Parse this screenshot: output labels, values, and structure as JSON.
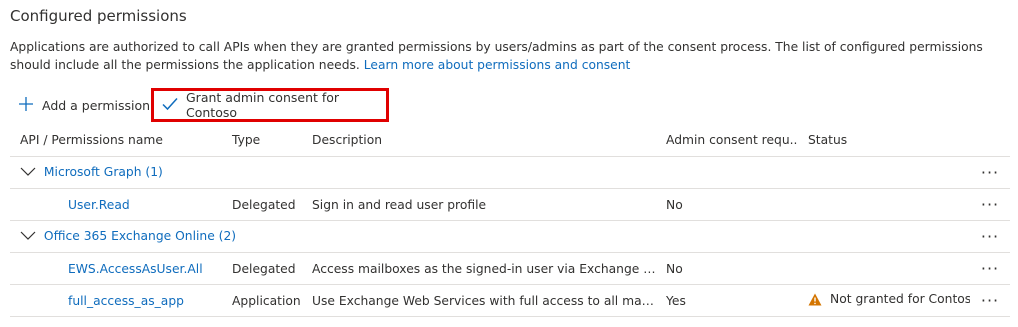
{
  "header": {
    "title": "Configured permissions",
    "description": "Applications are authorized to call APIs when they are granted permissions by users/admins as part of the consent process. The list of configured permissions should include all the permissions the application needs.",
    "learn_more": "Learn more about permissions and consent"
  },
  "toolbar": {
    "add_label": "Add a permission",
    "grant_label": "Grant admin consent for Contoso"
  },
  "table": {
    "columns": [
      "API / Permissions name",
      "Type",
      "Description",
      "Admin consent requ...",
      "Status"
    ],
    "groups": [
      {
        "name": "Microsoft Graph (1)",
        "rows": [
          {
            "name": "User.Read",
            "type": "Delegated",
            "description": "Sign in and read user profile",
            "admin": "No",
            "status": ""
          }
        ]
      },
      {
        "name": "Office 365 Exchange Online (2)",
        "rows": [
          {
            "name": "EWS.AccessAsUser.All",
            "type": "Delegated",
            "description": "Access mailboxes as the signed-in user via Exchange Web ...",
            "admin": "No",
            "status": ""
          },
          {
            "name": "full_access_as_app",
            "type": "Application",
            "description": "Use Exchange Web Services with full access to all mailboxes",
            "admin": "Yes",
            "status": "Not granted for Contoso"
          }
        ]
      }
    ],
    "more_label": "···"
  },
  "colors": {
    "link": "#0f6cbd",
    "highlight": "#e00000",
    "warning": "#d47500"
  }
}
